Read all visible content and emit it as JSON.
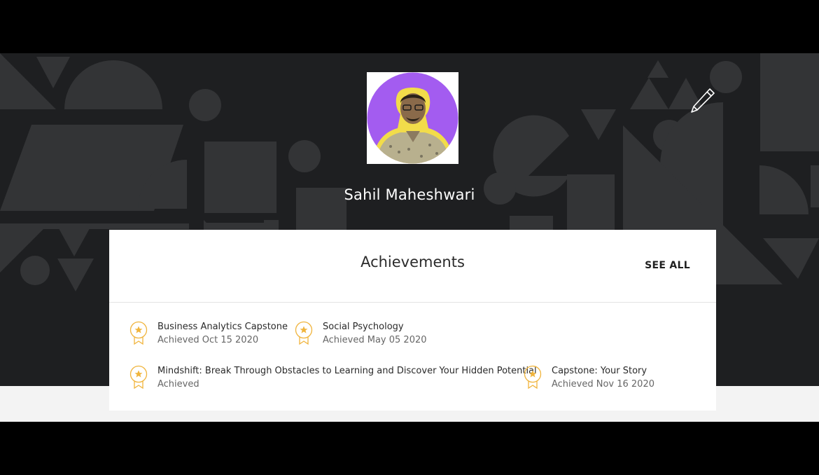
{
  "profile": {
    "name": "Sahil Maheshwari",
    "avatar_bg": "#a35cf0",
    "edit_icon": "pencil-icon"
  },
  "achievements": {
    "title": "Achievements",
    "see_all": "SEE ALL",
    "medal_color": "#f0b43c",
    "items": [
      {
        "name": "Business Analytics Capstone",
        "status": "Achieved Oct 15 2020"
      },
      {
        "name": "Social Psychology",
        "status": "Achieved May 05 2020"
      },
      {
        "name": "Mindshift: Break Through Obstacles to Learning and Discover Your Hidden Potential",
        "status": "Achieved"
      },
      {
        "name": "Capstone: Your Story",
        "status": "Achieved Nov 16 2020"
      }
    ]
  },
  "colors": {
    "hero_bg": "#1e1f21",
    "hero_shapes": "#333436",
    "lower_bg": "#f3f3f3"
  }
}
